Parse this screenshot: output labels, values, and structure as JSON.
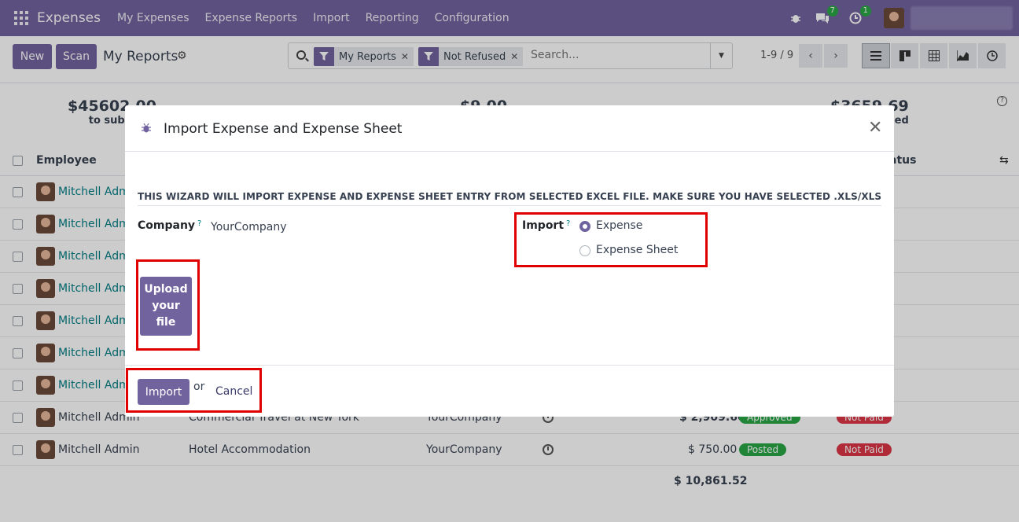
{
  "navbar": {
    "app_name": "Expenses",
    "menu": [
      "My Expenses",
      "Expense Reports",
      "Import",
      "Reporting",
      "Configuration"
    ],
    "messages_badge": "7",
    "activities_badge": "1"
  },
  "control_panel": {
    "new_label": "New",
    "scan_label": "Scan",
    "breadcrumb": "My Reports",
    "filters": [
      "My Reports",
      "Not Refused"
    ],
    "search_placeholder": "Search...",
    "pager": "1-9 / 9"
  },
  "stats": [
    {
      "amount": "$45602.00",
      "label": "to subm"
    },
    {
      "amount": "$9.00",
      "label": ""
    },
    {
      "amount": "$3659.69",
      "label": "sed"
    }
  ],
  "list": {
    "header_employee": "Employee",
    "header_status": "atus",
    "employee": "Mitchell Adm",
    "rows": [
      {
        "employee": "Mitchell Admin",
        "description": "Commercial Travel at New York",
        "company": "YourCompany",
        "amount": "$ 2,909.60",
        "status": "Approved",
        "payment": "Not Paid"
      },
      {
        "employee": "Mitchell Admin",
        "description": "Hotel Accommodation",
        "company": "YourCompany",
        "amount": "$ 750.00",
        "status": "Posted",
        "payment": "Not Paid"
      }
    ],
    "total": "$ 10,861.52"
  },
  "modal": {
    "title": "Import Expense and Expense Sheet",
    "note": "THIS WIZARD WILL IMPORT EXPENSE AND EXPENSE SHEET ENTRY FROM SELECTED EXCEL FILE. MAKE SURE YOU HAVE SELECTED .XLS/XLSX FILE...",
    "company_label": "Company",
    "company_value": "YourCompany",
    "import_label": "Import",
    "help_mark": "?",
    "options": [
      {
        "label": "Expense",
        "checked": true
      },
      {
        "label": "Expense Sheet",
        "checked": false
      }
    ],
    "upload_lines": [
      "Upload",
      "your",
      "file"
    ],
    "import_button": "Import",
    "or_text": "or",
    "cancel_label": "Cancel"
  },
  "colors": {
    "brand": "#71639e",
    "highlight": "#e10000",
    "approved": "#28a745",
    "not_paid": "#dc3545",
    "posted": "#28a745"
  }
}
